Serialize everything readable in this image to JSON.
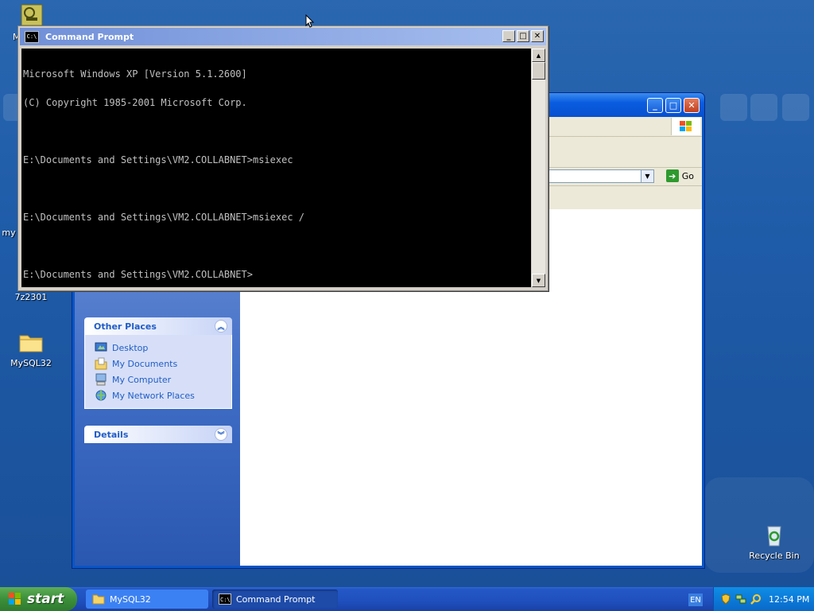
{
  "desktop": {
    "icons": [
      {
        "label": "M"
      },
      {
        "label": "my"
      },
      {
        "label": "7z2301"
      },
      {
        "label": "MySQL32"
      },
      {
        "label": "Recycle Bin"
      }
    ]
  },
  "cmd_window": {
    "title": "Command Prompt",
    "icon_text": "C:\\",
    "lines": [
      "Microsoft Windows XP [Version 5.1.2600]",
      "(C) Copyright 1985-2001 Microsoft Corp.",
      "",
      "E:\\Documents and Settings\\VM2.COLLABNET>msiexec",
      "",
      "E:\\Documents and Settings\\VM2.COLLABNET>msiexec /",
      "",
      "E:\\Documents and Settings\\VM2.COLLABNET>"
    ]
  },
  "explorer_window": {
    "go_label": "Go",
    "other_places": {
      "title": "Other Places",
      "items": [
        {
          "label": "Desktop",
          "icon": "desktop-icon"
        },
        {
          "label": "My Documents",
          "icon": "my-documents-icon"
        },
        {
          "label": "My Computer",
          "icon": "my-computer-icon"
        },
        {
          "label": "My Network Places",
          "icon": "network-places-icon"
        }
      ]
    },
    "details": {
      "title": "Details"
    }
  },
  "taskbar": {
    "start_label": "start",
    "tasks": [
      {
        "label": "MySQL32",
        "icon": "folder-icon",
        "active": false
      },
      {
        "label": "Command Prompt",
        "icon": "cmd-icon",
        "active": true
      }
    ],
    "language": "EN",
    "clock": "12:54 PM"
  }
}
